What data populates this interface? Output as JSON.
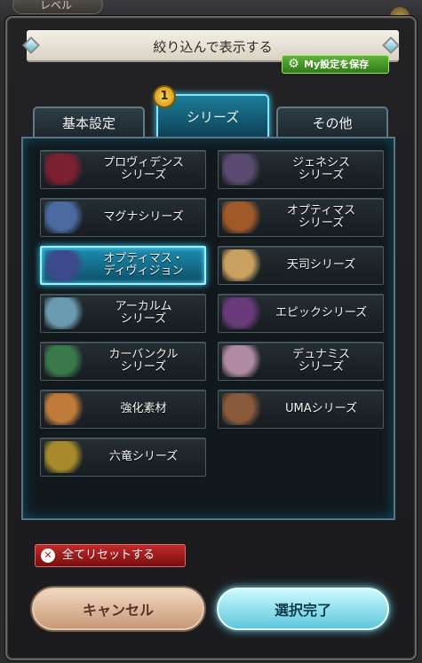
{
  "background": {
    "level_label": "レベル"
  },
  "dialog": {
    "title": "絞り込んで表示する",
    "save_button": "My設定を保存"
  },
  "tabs": [
    {
      "label": "基本設定"
    },
    {
      "label": "シリーズ",
      "selected": true
    },
    {
      "label": "その他"
    }
  ],
  "badge": "1",
  "series": [
    {
      "label": "プロヴィデンス\nシリーズ",
      "color": "#7a2030"
    },
    {
      "label": "ジェネシス\nシリーズ",
      "color": "#5a4a70"
    },
    {
      "label": "マグナシリーズ",
      "color": "#4a6aa0"
    },
    {
      "label": "オプティマス\nシリーズ",
      "color": "#a05a2a"
    },
    {
      "label": "オプティマス・\nディヴィジョン",
      "color": "#3a4a8a",
      "selected": true
    },
    {
      "label": "天司シリーズ",
      "color": "#c8a060"
    },
    {
      "label": "アーカルム\nシリーズ",
      "color": "#6a9ab0"
    },
    {
      "label": "エピックシリーズ",
      "color": "#6a3a7a"
    },
    {
      "label": "カーバンクル\nシリーズ",
      "color": "#3a7a4a"
    },
    {
      "label": "デュナミス\nシリーズ",
      "color": "#b08aa0"
    },
    {
      "label": "強化素材",
      "color": "#c07a3a"
    },
    {
      "label": "UMAシリーズ",
      "color": "#8a5a3a"
    },
    {
      "label": "六竜シリーズ",
      "color": "#a88a2a"
    }
  ],
  "reset_button": "全てリセットする",
  "cancel_button": "キャンセル",
  "confirm_button": "選択完了"
}
